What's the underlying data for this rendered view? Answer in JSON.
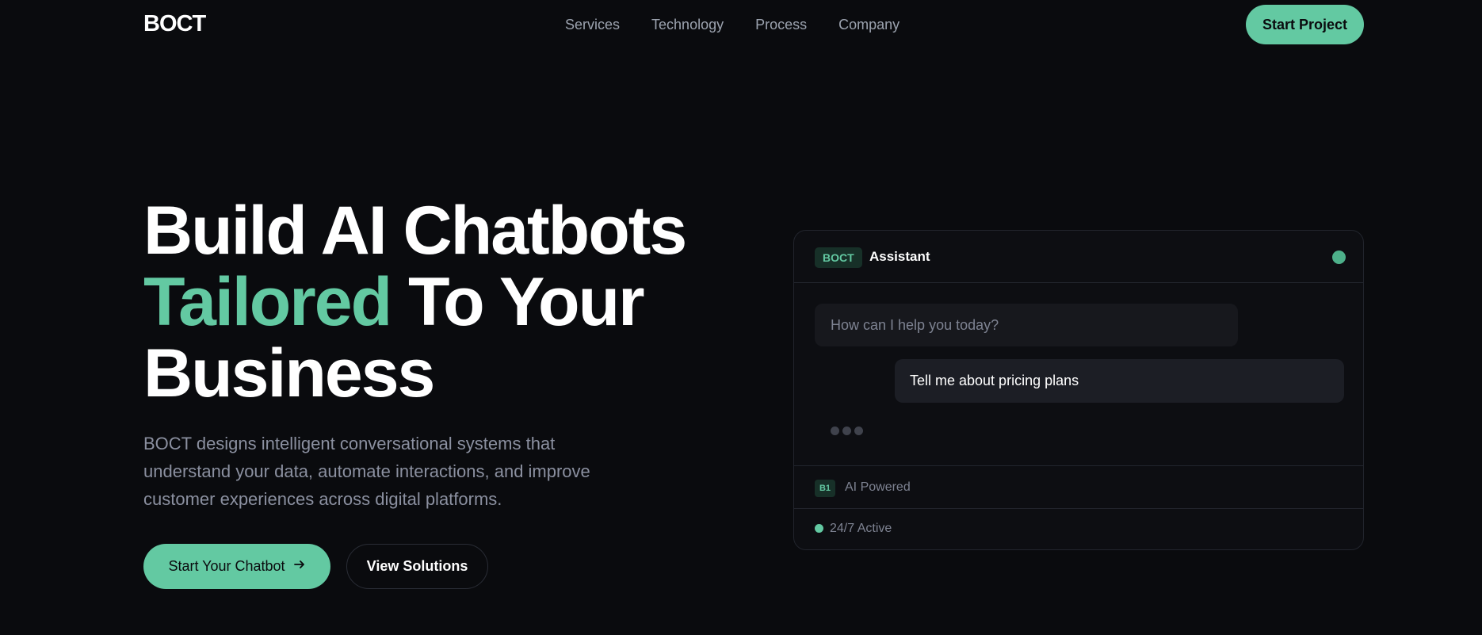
{
  "nav": {
    "logo": "BOCT",
    "links": [
      "Services",
      "Technology",
      "Process",
      "Company"
    ],
    "cta": "Start Project"
  },
  "hero": {
    "title_line1": "Build AI Chatbots",
    "title_accent": "Tailored",
    "title_line2_rest": " To Your",
    "title_line3": "Business",
    "description": "BOCT designs intelligent conversational systems that understand your data, automate interactions, and improve customer experiences across digital platforms.",
    "primary_button": "Start Your Chatbot",
    "secondary_button": "View Solutions"
  },
  "chat_card": {
    "badge": "BOCT",
    "title": "Assistant",
    "bot_message": "How can I help you today?",
    "user_message": "Tell me about pricing plans",
    "features": [
      {
        "badge": "B1",
        "label": "AI Powered"
      },
      {
        "label": "24/7 Active"
      }
    ]
  },
  "colors": {
    "accent": "#63c9a2",
    "background": "#0a0b0e",
    "muted_text": "#8b90a0"
  }
}
